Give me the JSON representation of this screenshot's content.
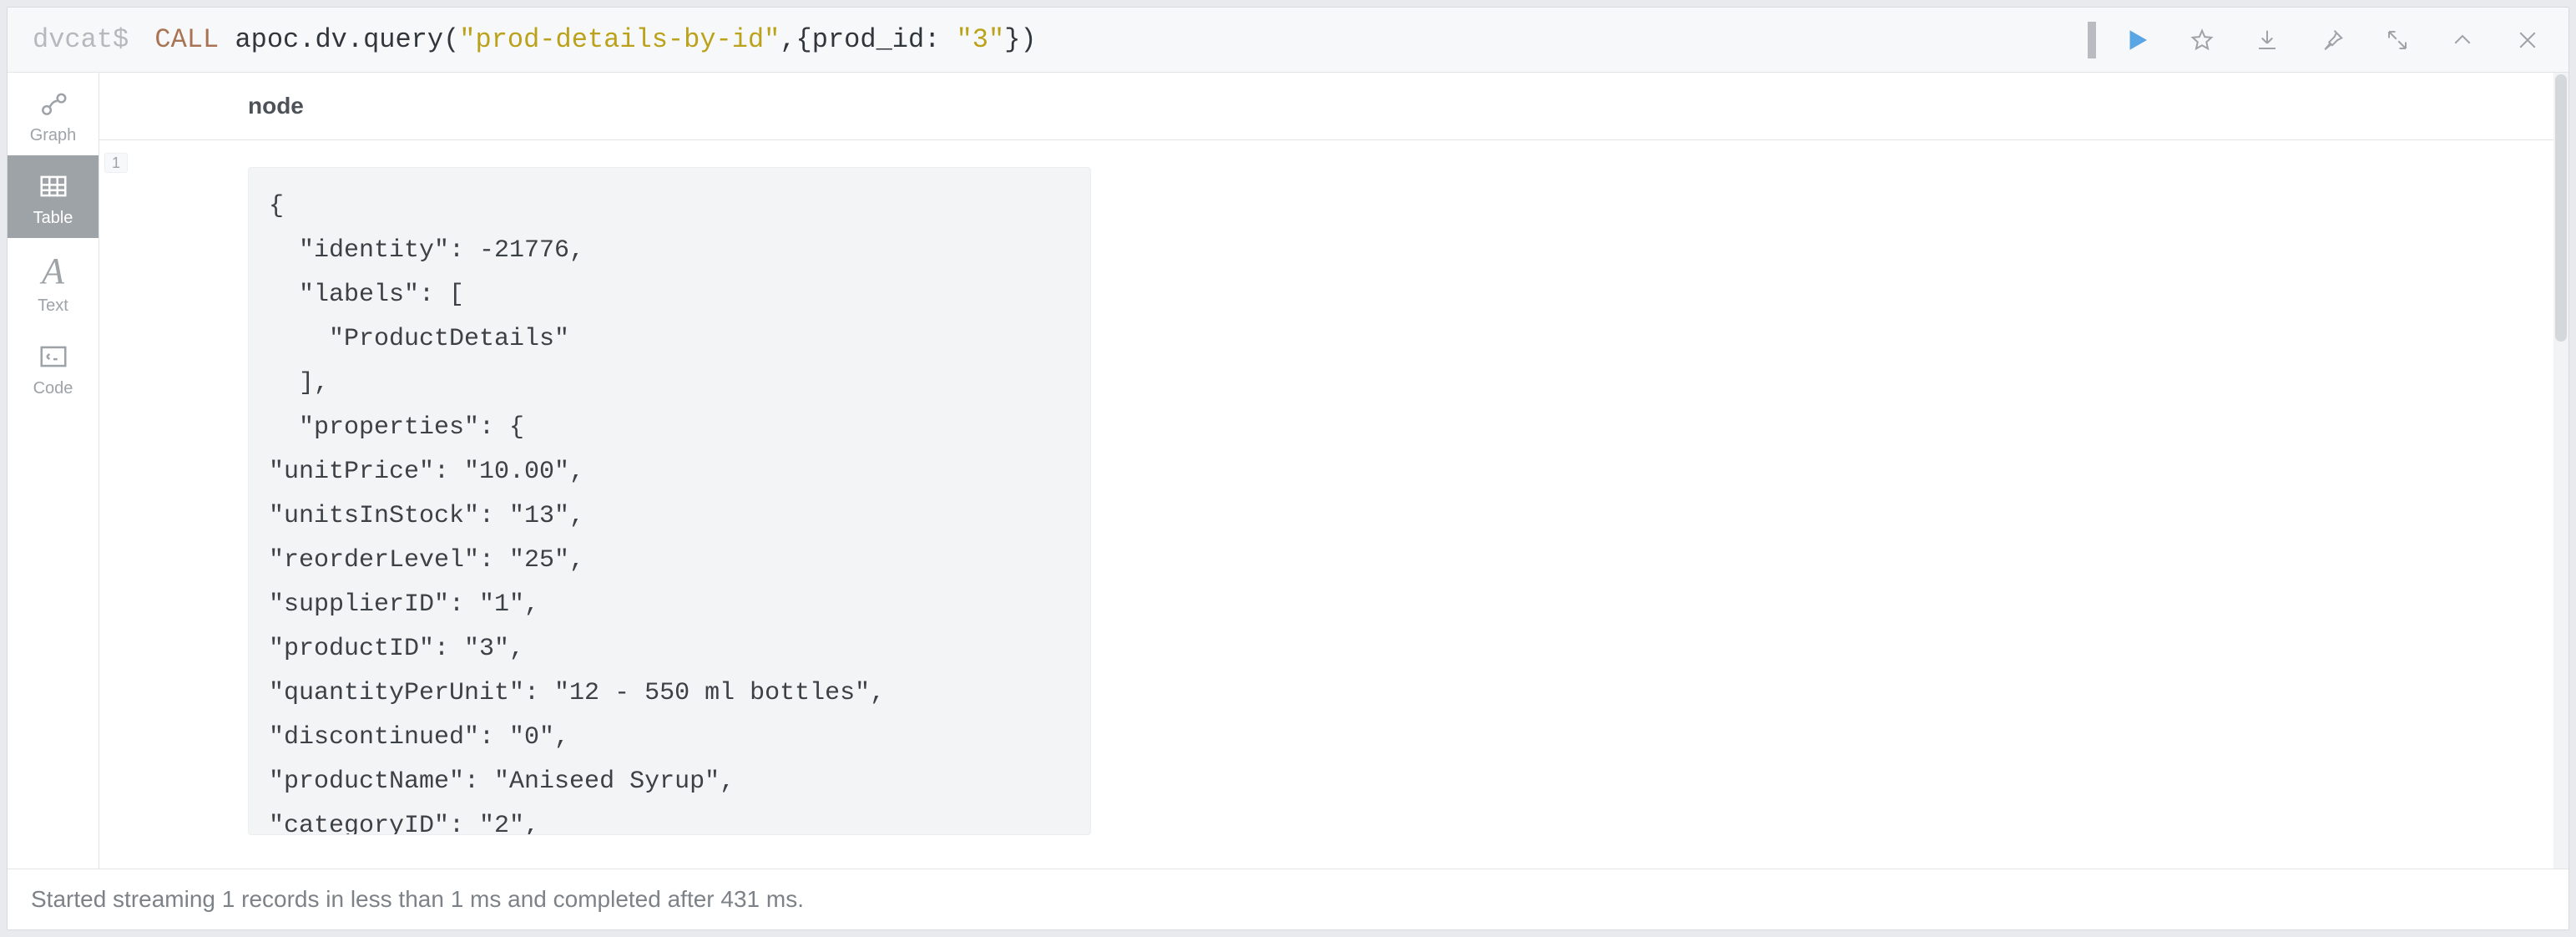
{
  "query": {
    "prompt": "dvcat$",
    "keyword": "CALL",
    "func": "apoc.dv.query",
    "arg1": "\"prod-details-by-id\"",
    "arg2a": "{prod_id: ",
    "arg2b": "\"3\"",
    "arg2c": "}"
  },
  "sidebar": {
    "graph": "Graph",
    "table": "Table",
    "text": "Text",
    "code": "Code"
  },
  "header": {
    "column": "node"
  },
  "row_number": "1",
  "node": {
    "identity": -21776,
    "labels": [
      "ProductDetails"
    ],
    "properties": {
      "unitPrice": "10.00",
      "unitsInStock": "13",
      "reorderLevel": "25",
      "supplierID": "1",
      "productID": "3",
      "quantityPerUnit": "12 - 550 ml bottles",
      "discontinued": "0",
      "productName": "Aniseed Syrup",
      "categoryID": "2"
    }
  },
  "status": "Started streaming 1 records in less than 1 ms and completed after 431 ms.",
  "code_lines": [
    "{",
    "  \"identity\": -21776,",
    "  \"labels\": [",
    "    \"ProductDetails\"",
    "  ],",
    "  \"properties\": {",
    "\"unitPrice\": \"10.00\",",
    "\"unitsInStock\": \"13\",",
    "\"reorderLevel\": \"25\",",
    "\"supplierID\": \"1\",",
    "\"productID\": \"3\",",
    "\"quantityPerUnit\": \"12 - 550 ml bottles\",",
    "\"discontinued\": \"0\",",
    "\"productName\": \"Aniseed Syrup\",",
    "\"categoryID\": \"2\","
  ]
}
